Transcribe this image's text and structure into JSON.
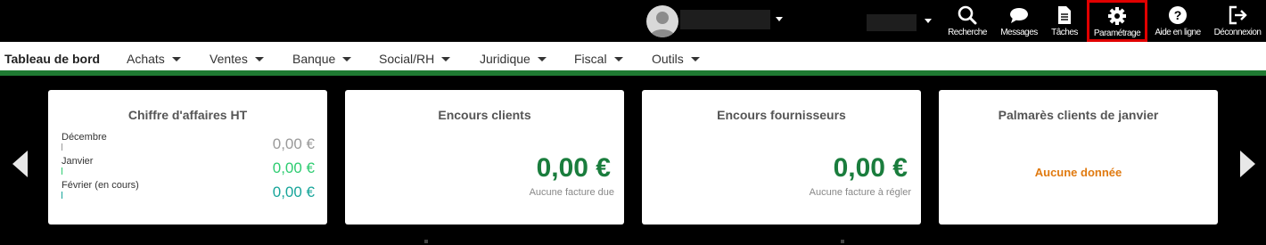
{
  "header": {
    "tools": [
      {
        "label": "Recherche",
        "icon": "search-icon"
      },
      {
        "label": "Messages",
        "icon": "chat-bubble-icon"
      },
      {
        "label": "Tâches",
        "icon": "document-icon"
      },
      {
        "label": "Paramétrage",
        "icon": "gear-icon"
      },
      {
        "label": "Aide en ligne",
        "icon": "help-icon"
      },
      {
        "label": "Déconnexion",
        "icon": "logout-icon"
      }
    ]
  },
  "nav": {
    "items": [
      {
        "label": "Tableau de bord"
      },
      {
        "label": "Achats"
      },
      {
        "label": "Ventes"
      },
      {
        "label": "Banque"
      },
      {
        "label": "Social/RH"
      },
      {
        "label": "Juridique"
      },
      {
        "label": "Fiscal"
      },
      {
        "label": "Outils"
      }
    ]
  },
  "cards": {
    "revenue": {
      "title": "Chiffre d'affaires HT",
      "rows": [
        {
          "label": "Décembre",
          "value": "0,00 €",
          "color": "#9a9a9a"
        },
        {
          "label": "Janvier",
          "value": "0,00 €",
          "color": "#2ecc71"
        },
        {
          "label": "Février (en cours)",
          "value": "0,00 €",
          "color": "#17a59a"
        }
      ]
    },
    "clients": {
      "title": "Encours clients",
      "amount": "0,00 €",
      "note": "Aucune facture due"
    },
    "suppliers": {
      "title": "Encours fournisseurs",
      "amount": "0,00 €",
      "note": "Aucune facture à régler"
    },
    "ranking": {
      "title": "Palmarès clients de janvier",
      "empty": "Aucune donnée"
    }
  },
  "colors": {
    "accent": "#1f7a32",
    "amount": "#1a7d3d",
    "highlight": "#e00000",
    "warning": "#e07a10"
  }
}
